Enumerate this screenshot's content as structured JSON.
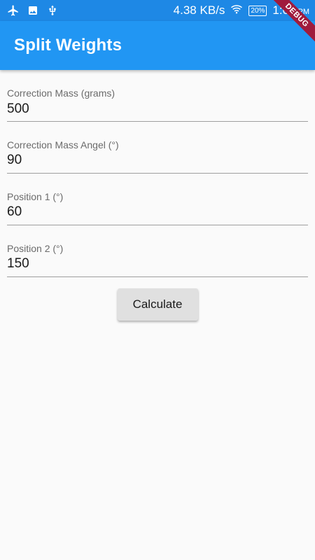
{
  "status_bar": {
    "network_speed": "4.38 KB/s",
    "battery": "20%",
    "time": "1:07",
    "ampm": "PM",
    "icons": [
      "airplane-icon",
      "image-icon",
      "usb-icon",
      "wifi-icon",
      "battery-icon"
    ]
  },
  "app_bar": {
    "title": "Split Weights",
    "debug_label": "DEBUG"
  },
  "form": {
    "fields": [
      {
        "label": "Correction Mass (grams)",
        "value": "500"
      },
      {
        "label": "Correction Mass Angel (°)",
        "value": "90"
      },
      {
        "label": "Position 1 (°)",
        "value": "60"
      },
      {
        "label": "Position 2 (°)",
        "value": "150"
      }
    ],
    "calculate_label": "Calculate"
  },
  "colors": {
    "status_bar": "#1e88e5",
    "app_bar": "#2196f3",
    "background": "#fafafa",
    "debug_banner": "#a01b3d",
    "button": "#e0e0e0"
  }
}
